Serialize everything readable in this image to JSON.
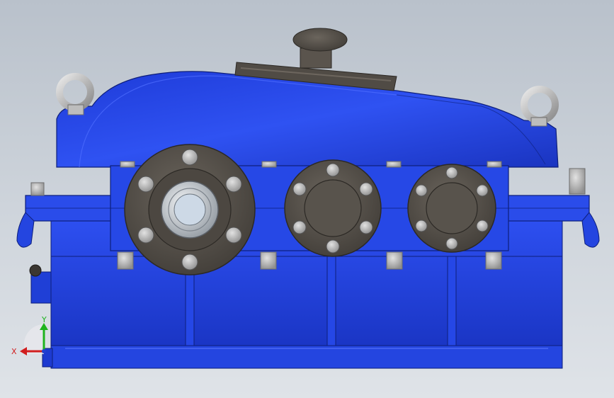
{
  "viewport": {
    "background_top": "#b9c1cb",
    "background_bottom": "#dfe3e8"
  },
  "model": {
    "part_color": "#1f3fd6",
    "part_color_dark": "#142b9e",
    "part_color_light": "#3a5cf0",
    "casting_color": "#55504a",
    "fastener_color": "#b9b9b9",
    "eyebolt_color": "#c4c4c4"
  },
  "triad": {
    "x_label": "X",
    "y_label": "Y",
    "x_color": "#d11e1e",
    "y_color": "#1eb31e",
    "z_color": "#2240d0"
  }
}
